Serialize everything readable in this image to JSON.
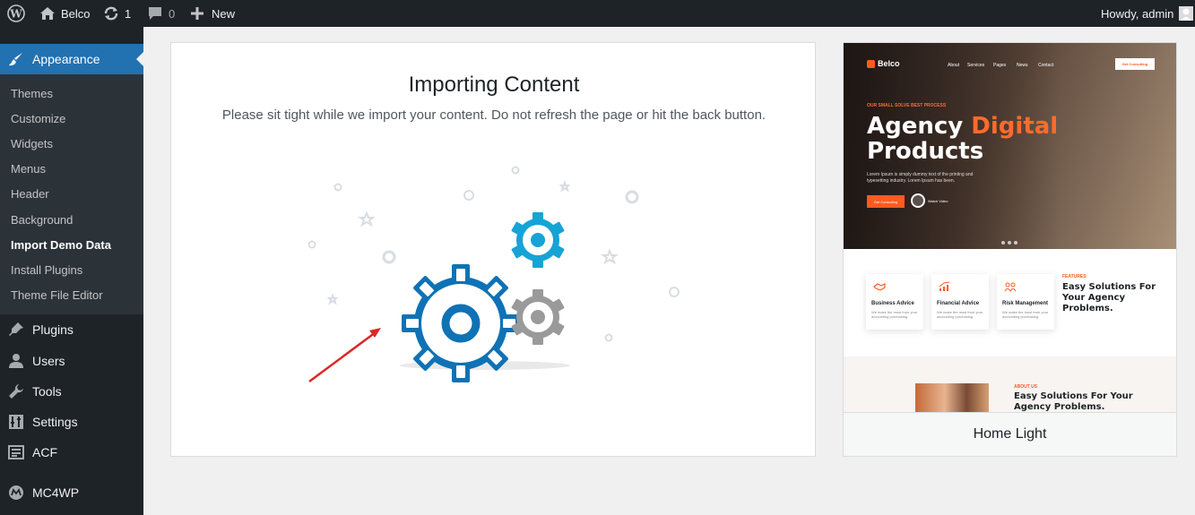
{
  "admin_bar": {
    "site_name": "Belco",
    "updates_count": "1",
    "comments_count": "0",
    "new_label": "New",
    "greeting": "Howdy, admin"
  },
  "sidebar": {
    "appearance_label": "Appearance",
    "submenu": [
      {
        "label": "Themes"
      },
      {
        "label": "Customize"
      },
      {
        "label": "Widgets"
      },
      {
        "label": "Menus"
      },
      {
        "label": "Header"
      },
      {
        "label": "Background"
      },
      {
        "label": "Import Demo Data",
        "current": true
      },
      {
        "label": "Install Plugins"
      },
      {
        "label": "Theme File Editor"
      }
    ],
    "items": [
      {
        "label": "Plugins",
        "icon": "plugin-icon"
      },
      {
        "label": "Users",
        "icon": "user-icon"
      },
      {
        "label": "Tools",
        "icon": "wrench-icon"
      },
      {
        "label": "Settings",
        "icon": "settings-icon"
      },
      {
        "label": "ACF",
        "icon": "acf-icon"
      },
      {
        "label": "MC4WP",
        "icon": "mc4wp-icon"
      }
    ],
    "accent_color": "#2271b1"
  },
  "import": {
    "title": "Importing Content",
    "description": "Please sit tight while we import your content. Do not refresh the page or hit the back button.",
    "gear_colors": {
      "large": "#0f72b5",
      "small_top": "#16a3d6",
      "small_bottom": "#9a9a9a"
    },
    "arrow_color": "#e02424"
  },
  "demo": {
    "name": "Home Light",
    "preview": {
      "logo": "Belco",
      "nav": [
        "About",
        "Services",
        "Pages",
        "News",
        "Contact"
      ],
      "consult_button": "Get Consulting",
      "hero_kicker": "OUR SMALL SOLVE BEST PROCESS",
      "hero_title_part1": "Agency ",
      "hero_title_accent": "Digital",
      "hero_title_part2": "Products",
      "hero_text": "Lorem Ipsum is simply dummy text of the printing and typesetting industry. Lorem Ipsum has been.",
      "hero_button": "Get Consulting",
      "hero_play_label": "Watch Video",
      "features": [
        {
          "title": "Business Advice",
          "text": "We make the most from your accounting purchasing."
        },
        {
          "title": "Financial Advice",
          "text": "We make the most from your accounting purchasing."
        },
        {
          "title": "Risk Management",
          "text": "We make the most from your accounting purchasing."
        }
      ],
      "features_kicker": "FEATURES",
      "features_heading": "Easy Solutions For Your Agency Problems.",
      "about_kicker": "ABOUT US",
      "about_heading": "Easy Solutions For Your Agency Problems.",
      "accent_color": "#ff5a1f"
    }
  }
}
